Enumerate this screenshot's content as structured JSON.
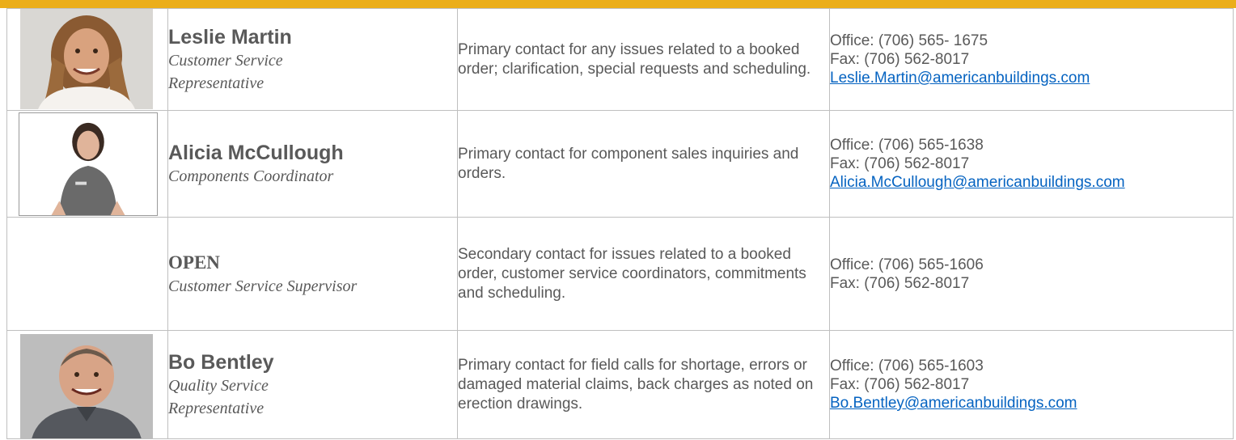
{
  "colors": {
    "accent": "#EBAE1A",
    "text": "#595959",
    "link": "#0563C1",
    "border": "#bfbfbf"
  },
  "contacts": [
    {
      "photo": "photo-of-woman-long-hair",
      "name": "Leslie Martin",
      "title_line1": "Customer Service",
      "title_line2": "Representative",
      "description": "Primary contact for any issues related to a booked order; clarification, special requests and scheduling.",
      "office": "Office:  (706) 565- 1675",
      "fax": "Fax:  (706) 562-8017",
      "email": "Leslie.Martin@americanbuildings.com"
    },
    {
      "photo": "photo-of-woman-grey-shirt",
      "name": "Alicia McCullough",
      "title_line1": "Components Coordinator",
      "description": "Primary contact for component sales inquiries and orders.",
      "office": "Office:  (706) 565-1638",
      "fax": "Fax:  (706) 562-8017",
      "email": "Alicia.McCullough@americanbuildings.com"
    },
    {
      "name": "OPEN",
      "title_line1": "Customer Service Supervisor",
      "description": "Secondary contact for issues related to a booked order, customer service coordinators, commitments and scheduling.",
      "office": "Office:  (706) 565-1606",
      "fax": "Fax:  (706) 562-8017"
    },
    {
      "photo": "photo-of-man-grey-polo",
      "name": "Bo Bentley",
      "title_line1": "Quality Service",
      "title_line2": "Representative",
      "description": "Primary contact for field calls for shortage, errors or damaged material claims, back charges as noted on erection drawings.",
      "office": "Office:  (706) 565-1603",
      "fax": "Fax:  (706) 562-8017",
      "email": "Bo.Bentley@americanbuildings.com"
    }
  ]
}
